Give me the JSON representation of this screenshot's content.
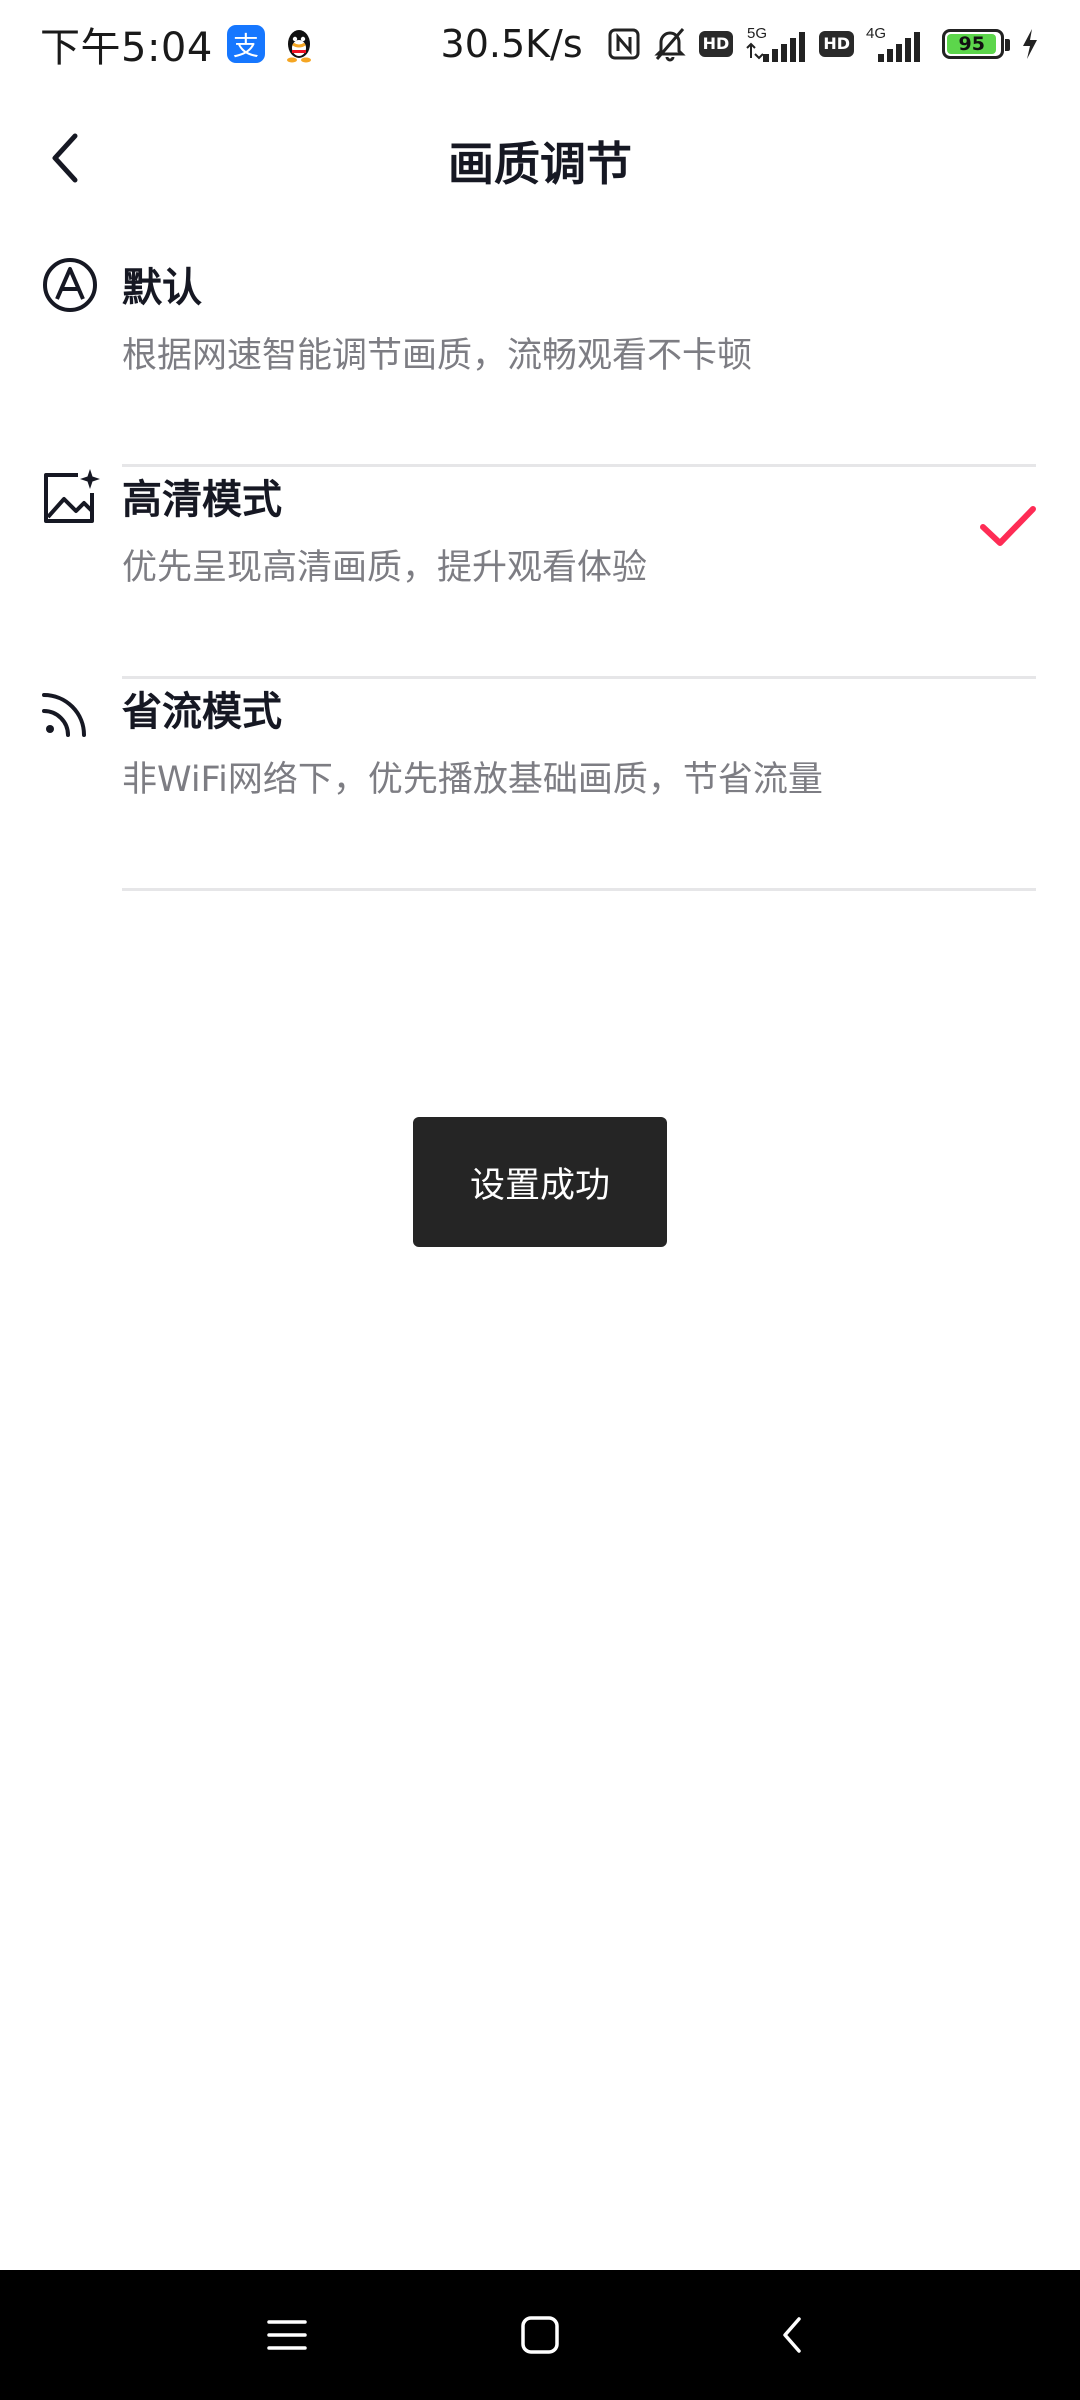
{
  "status_bar": {
    "time": "下午5:04",
    "app_badge": "支",
    "net_speed": "30.5K/s",
    "network_5g": "5G",
    "network_4g": "4G",
    "hd_label": "HD",
    "battery": "95",
    "battery_level": 0.95,
    "icons": [
      "alipay-icon",
      "qq-icon",
      "nfc-icon",
      "mute-bell-icon",
      "hd-icon",
      "signal-5g-icon",
      "signal-4g-icon",
      "battery-icon",
      "charging-icon"
    ]
  },
  "header": {
    "title": "画质调节",
    "back_icon": "chevron-left-icon"
  },
  "options": [
    {
      "title": "默认",
      "desc": "根据网速智能调节画质，流畅观看不卡顿",
      "icon": "auto-a-icon",
      "selected": false
    },
    {
      "title": "高清模式",
      "desc": "优先呈现高清画质，提升观看体验",
      "icon": "hd-image-icon",
      "selected": true
    },
    {
      "title": "省流模式",
      "desc": "非WiFi网络下，优先播放基础画质，节省流量",
      "icon": "data-saver-icon",
      "selected": false
    }
  ],
  "toast": {
    "text": "设置成功"
  },
  "colors": {
    "accent": "#fe2c55",
    "text_primary": "#161823",
    "text_secondary": "#7d7d83",
    "toast_bg": "#252525",
    "divider": "#e6e6e8"
  },
  "nav_bar": {
    "icons": [
      "menu-icon",
      "home-icon",
      "back-icon"
    ]
  }
}
